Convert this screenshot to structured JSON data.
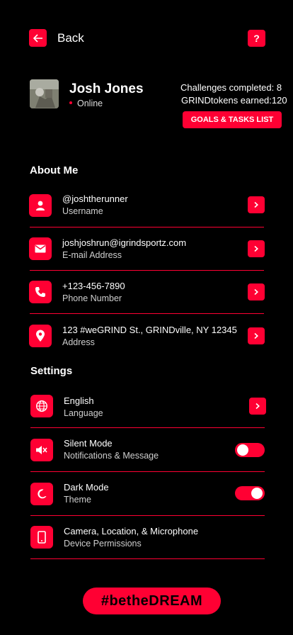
{
  "header": {
    "back_label": "Back",
    "help_label": "?"
  },
  "profile": {
    "name": "Josh Jones",
    "status": "Online",
    "challenges": "Challenges completed: 8",
    "tokens": "GRINDtokens earned:120",
    "goals_button": "GOALS & TASKS LIST"
  },
  "about": {
    "title": "About Me",
    "items": [
      {
        "value": "@joshtherunner",
        "label": "Username",
        "icon": "user-icon"
      },
      {
        "value": "joshjoshrun@igrindsportz.com",
        "label": "E-mail Address",
        "icon": "mail-icon"
      },
      {
        "value": "+123-456-7890",
        "label": "Phone Number",
        "icon": "phone-icon"
      },
      {
        "value": "123 #weGRIND St., GRINDville, NY 12345",
        "label": "Address",
        "icon": "location-pin-icon"
      }
    ]
  },
  "settings": {
    "title": "Settings",
    "items": [
      {
        "value": "English",
        "label": "Language",
        "icon": "globe-icon",
        "control": "chevron"
      },
      {
        "value": "Silent Mode",
        "label": "Notifications & Message",
        "icon": "mute-icon",
        "control": "toggle",
        "on": false
      },
      {
        "value": "Dark Mode",
        "label": "Theme",
        "icon": "moon-icon",
        "control": "toggle",
        "on": true
      },
      {
        "value": "Camera, Location, & Microphone",
        "label": "Device Permissions",
        "icon": "device-icon",
        "control": "none"
      }
    ]
  },
  "footer": {
    "hashtag": "#betheDREAM"
  },
  "colors": {
    "accent": "#ff0033",
    "background": "#000000"
  }
}
